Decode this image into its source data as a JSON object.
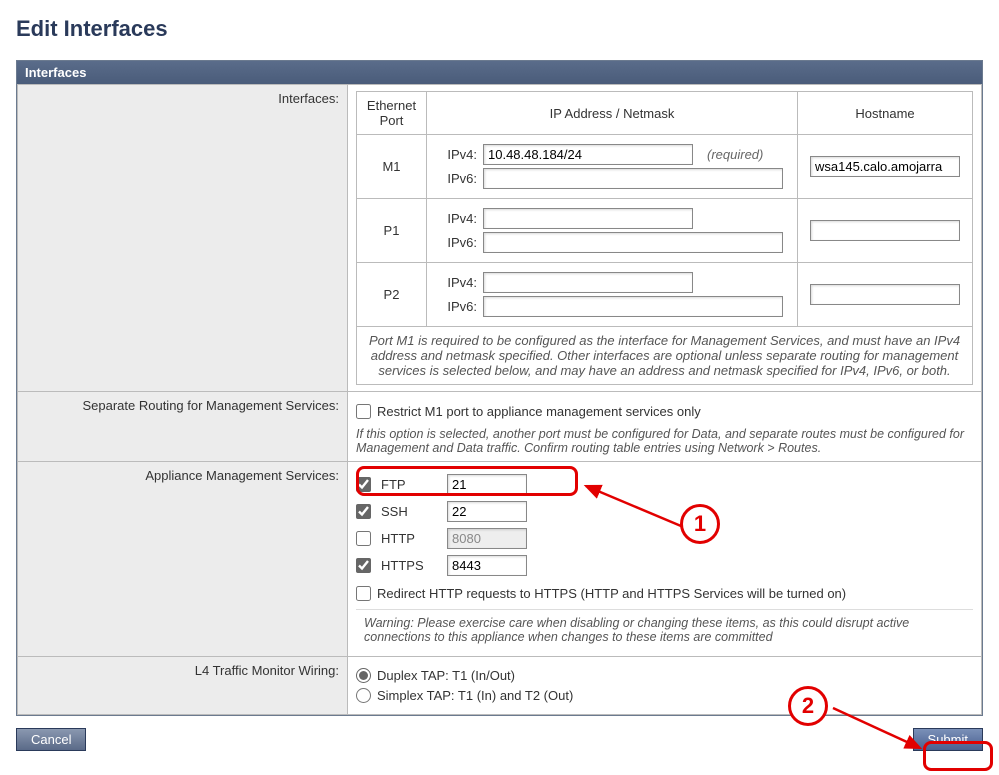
{
  "title": "Edit Interfaces",
  "panel_title": "Interfaces",
  "labels": {
    "interfaces": "Interfaces:",
    "separate_routing": "Separate Routing for Management Services:",
    "appliance_mgmt": "Appliance Management Services:",
    "l4_wiring": "L4 Traffic Monitor Wiring:"
  },
  "iface_headers": {
    "port": "Ethernet Port",
    "ip": "IP Address / Netmask",
    "host": "Hostname"
  },
  "ip_labels": {
    "v4": "IPv4:",
    "v6": "IPv6:"
  },
  "required_text": "(required)",
  "ifaces": {
    "m1": {
      "name": "M1",
      "ipv4": "10.48.48.184/24",
      "ipv6": "",
      "host": "wsa145.calo.amojarra"
    },
    "p1": {
      "name": "P1",
      "ipv4": "",
      "ipv6": "",
      "host": ""
    },
    "p2": {
      "name": "P2",
      "ipv4": "",
      "ipv6": "",
      "host": ""
    }
  },
  "iface_note": "Port M1 is required to be configured as the interface for Management Services, and must have an IPv4 address and netmask specified. Other interfaces are optional unless separate routing for management services is selected below, and may have an address and netmask specified for IPv4, IPv6, or both.",
  "sep_route": {
    "checkbox_label": "Restrict M1 port to appliance management services only",
    "note": "If this option is selected, another port must be configured for Data, and separate routes must be configured for Management and Data traffic. Confirm routing table entries using Network > Routes."
  },
  "services": {
    "ftp": {
      "label": "FTP",
      "port": "21",
      "checked": true,
      "enabled": true
    },
    "ssh": {
      "label": "SSH",
      "port": "22",
      "checked": true,
      "enabled": true
    },
    "http": {
      "label": "HTTP",
      "port": "8080",
      "checked": false,
      "enabled": false
    },
    "https": {
      "label": "HTTPS",
      "port": "8443",
      "checked": true,
      "enabled": true
    },
    "redirect_label": "Redirect HTTP requests to HTTPS (HTTP and HTTPS Services will be turned on)",
    "warning": "Warning: Please exercise care when disabling or changing these items, as this could disrupt active connections to this appliance when changes to these items are committed"
  },
  "l4": {
    "duplex": "Duplex TAP: T1 (In/Out)",
    "simplex": "Simplex TAP: T1 (In) and T2 (Out)"
  },
  "buttons": {
    "cancel": "Cancel",
    "submit": "Submit"
  },
  "annotations": {
    "c1": "1",
    "c2": "2"
  }
}
